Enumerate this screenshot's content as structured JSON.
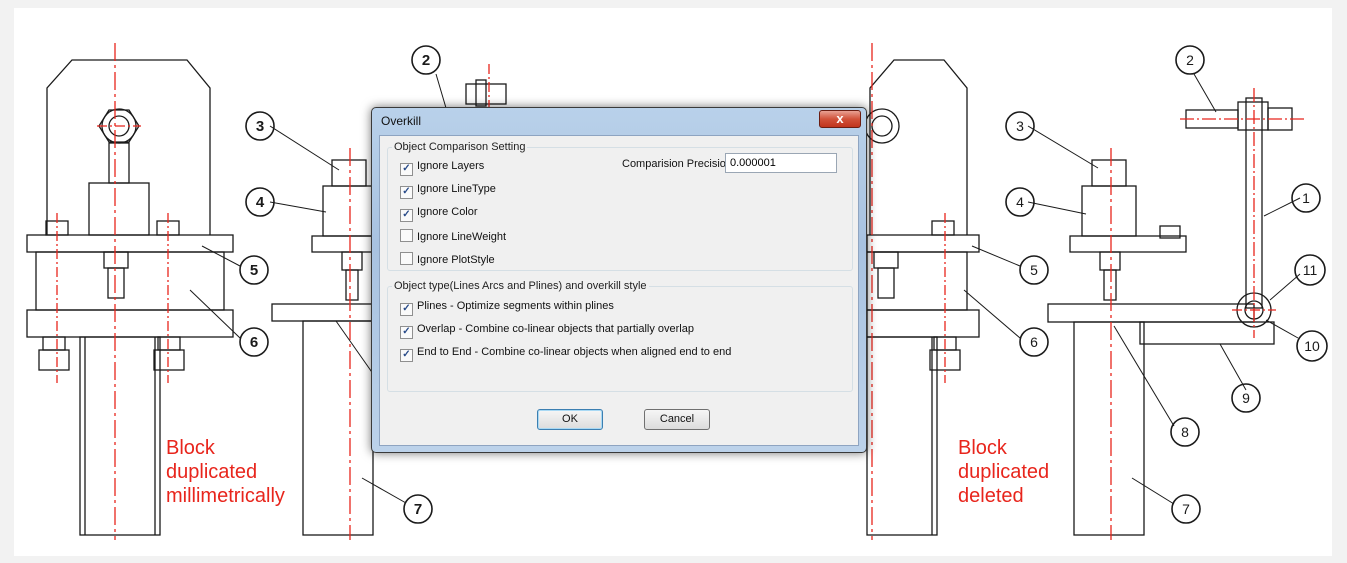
{
  "drawing": {
    "notes": {
      "left": [
        "Block",
        "duplicated",
        "millimetrically"
      ],
      "right": [
        "Block",
        "duplicated",
        "deleted"
      ]
    },
    "left_callouts": [
      "2",
      "3",
      "4",
      "5",
      "6",
      "7"
    ],
    "right_callouts": [
      "1",
      "2",
      "3",
      "4",
      "5",
      "6",
      "7",
      "8",
      "9",
      "10",
      "11"
    ]
  },
  "dialog": {
    "title": "Overkill",
    "close_glyph": "x",
    "comparison": {
      "legend": "Object Comparison Setting",
      "precision_label": "Comparision Precision:",
      "precision_value": "0.000001",
      "options": [
        {
          "label": "Ignore Layers",
          "checked": true
        },
        {
          "label": "Ignore LineType",
          "checked": true
        },
        {
          "label": "Ignore Color",
          "checked": true
        },
        {
          "label": "Ignore LineWeight",
          "checked": false
        },
        {
          "label": "Ignore PlotStyle",
          "checked": false
        }
      ]
    },
    "style": {
      "legend": "Object type(Lines Arcs and Plines) and overkill style",
      "options": [
        {
          "label": "Plines - Optimize segments within plines",
          "checked": true
        },
        {
          "label": "Overlap - Combine co-linear objects that partially overlap",
          "checked": true
        },
        {
          "label": "End to End - Combine co-linear objects when aligned end to end",
          "checked": true
        }
      ]
    },
    "ok_label": "OK",
    "cancel_label": "Cancel"
  },
  "colors": {
    "note_red": "#e8251c",
    "centerline_red": "#e8251c",
    "dialog_frame": "#b9d1ea",
    "close_button": "#c0341d"
  }
}
